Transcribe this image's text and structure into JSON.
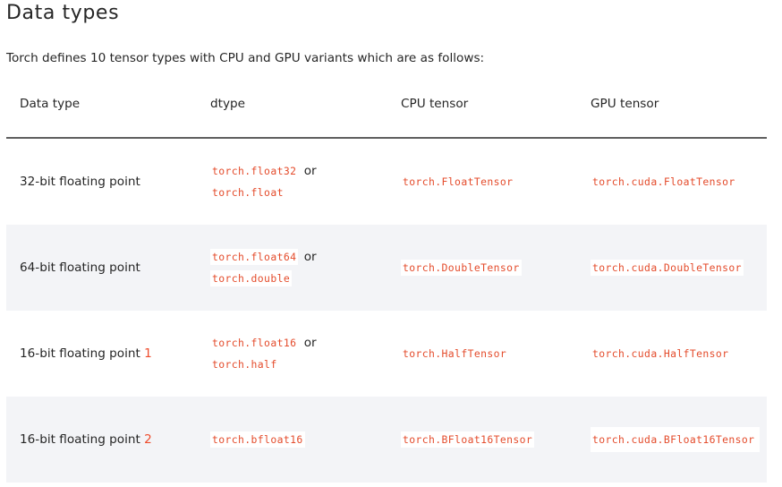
{
  "heading": "Data types",
  "intro": "Torch defines 10 tensor types with CPU and GPU variants which are as follows:",
  "columns": [
    "Data type",
    "dtype",
    "CPU tensor",
    "GPU tensor"
  ],
  "rows": [
    {
      "data_type": "32-bit floating point",
      "footnote": "",
      "dtype_primary": "torch.float32",
      "or_word": "or",
      "dtype_alias": "torch.float",
      "cpu_tensor": "torch.FloatTensor",
      "gpu_tensor": "torch.cuda.FloatTensor"
    },
    {
      "data_type": "64-bit floating point",
      "footnote": "",
      "dtype_primary": "torch.float64",
      "or_word": "or",
      "dtype_alias": "torch.double",
      "cpu_tensor": "torch.DoubleTensor",
      "gpu_tensor": "torch.cuda.DoubleTensor"
    },
    {
      "data_type": "16-bit floating point",
      "footnote": "1",
      "dtype_primary": "torch.float16",
      "or_word": "or",
      "dtype_alias": "torch.half",
      "cpu_tensor": "torch.HalfTensor",
      "gpu_tensor": "torch.cuda.HalfTensor"
    },
    {
      "data_type": "16-bit floating point",
      "footnote": "2",
      "dtype_primary": "torch.bfloat16",
      "or_word": "",
      "dtype_alias": "",
      "cpu_tensor": "torch.BFloat16Tensor",
      "gpu_tensor": "torch.cuda.BFloat16Tensor"
    }
  ],
  "colors": {
    "code_text": "#e44c2c",
    "link": "#ee4c2c",
    "alt_row_bg": "#f3f4f7",
    "header_rule": "#5f5f5f"
  }
}
